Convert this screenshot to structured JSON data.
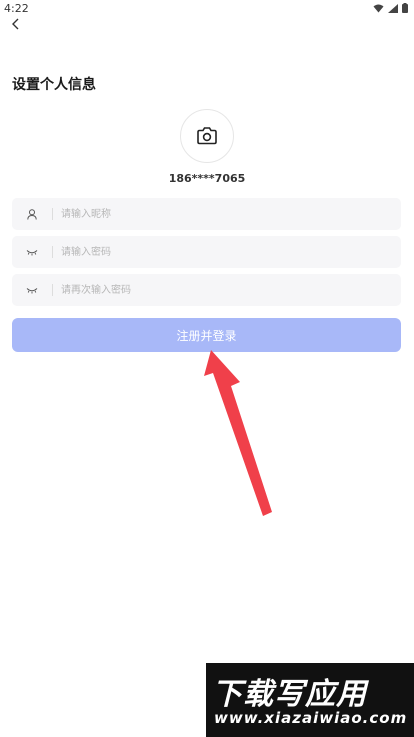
{
  "status_bar": {
    "time": "4:22",
    "icons": [
      "wifi-icon",
      "signal-icon",
      "battery-icon"
    ]
  },
  "header": {
    "back_icon": "chevron-left-icon",
    "title": "设置个人信息"
  },
  "profile": {
    "avatar_icon": "camera-icon",
    "phone": "186****7065"
  },
  "form": {
    "nickname": {
      "icon": "user-icon",
      "value": "",
      "placeholder": "请输入昵称"
    },
    "password": {
      "icon": "eye-closed-icon",
      "value": "",
      "placeholder": "请输入密码"
    },
    "password_confirm": {
      "icon": "eye-closed-icon",
      "value": "",
      "placeholder": "请再次输入密码"
    },
    "submit_label": "注册并登录"
  },
  "watermark": {
    "main": "下载写应用",
    "url": "www.xiazaiwiao.com"
  },
  "colors": {
    "button": "#a8b8f8",
    "field_bg": "#f6f6f8",
    "arrow": "#f0404a"
  }
}
